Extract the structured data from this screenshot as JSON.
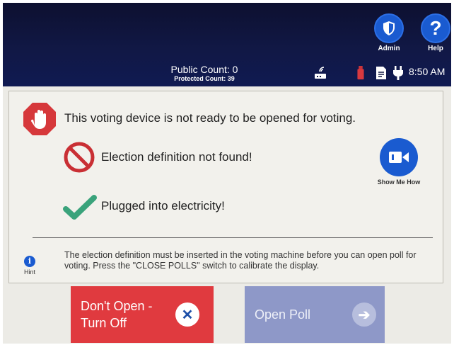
{
  "header": {
    "admin_label": "Admin",
    "help_label": "Help",
    "help_glyph": "?",
    "public_count": "Public Count: 0",
    "protected_count": "Protected Count: 39",
    "time": "8:50 AM",
    "icons": [
      "shield-icon",
      "question-icon",
      "network-icon",
      "usb-drive-icon",
      "document-icon",
      "power-plug-icon"
    ]
  },
  "status": {
    "main_message": "This voting device is not ready to be opened for voting.",
    "error_message": "Election definition not found!",
    "ok_message": "Plugged into electricity!",
    "show_me_how_label": "Show Me How"
  },
  "hint": {
    "glyph": "i",
    "label": "Hint",
    "text": "The election definition must be inserted in the voting machine before you can open poll for voting.  Press the \"CLOSE POLLS\" switch to calibrate the display."
  },
  "buttons": {
    "dont_open_line1": "Don't Open -",
    "dont_open_line2": "Turn Off",
    "dont_open_glyph": "✕",
    "open_poll_label": "Open Poll",
    "open_poll_glyph": "➔"
  },
  "colors": {
    "header_bg": "#111845",
    "accent_blue": "#1a5bd0",
    "stop_red": "#d6383b",
    "check_green": "#3aa37b",
    "dont_open_red": "#e03a3f",
    "open_poll_disabled": "#8e98c8"
  }
}
